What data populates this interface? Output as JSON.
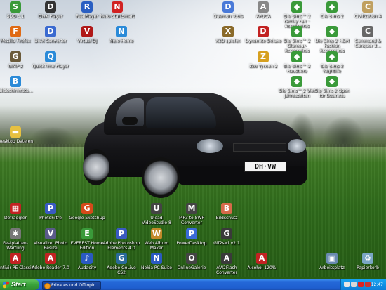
{
  "desktop": {
    "icons": [
      {
        "id": "sdl",
        "label": "SDD 3.1",
        "icon": "sdd-icon",
        "color": "#3a9a3a",
        "glyph": "S"
      },
      {
        "id": "divx-player",
        "label": "DivX Player",
        "icon": "divx-player-icon",
        "color": "#333333",
        "glyph": "D"
      },
      {
        "id": "realplayer",
        "label": "RealPlayer",
        "icon": "realplayer-icon",
        "color": "#2a5fc2",
        "glyph": "R"
      },
      {
        "id": "nero-startsmart",
        "label": "Nero StartSmart",
        "icon": "nero-icon",
        "color": "#d12222",
        "glyph": "N"
      },
      {
        "id": "mozilla-firefox",
        "label": "Mozilla Firefox",
        "icon": "firefox-icon",
        "color": "#e06a14",
        "glyph": "F"
      },
      {
        "id": "divx-converter",
        "label": "DivX Converter",
        "icon": "divx-converter-icon",
        "color": "#3a6ad0",
        "glyph": "D"
      },
      {
        "id": "virtual-dj",
        "label": "Virtual DJ",
        "icon": "virtual-dj-icon",
        "color": "#b01818",
        "glyph": "V"
      },
      {
        "id": "nero-home",
        "label": "Nero Home",
        "icon": "nero-home-icon",
        "color": "#2a8ad8",
        "glyph": "N"
      },
      {
        "id": "gimp",
        "label": "GIMP 2",
        "icon": "gimp-icon",
        "color": "#6a5a3a",
        "glyph": "G"
      },
      {
        "id": "quicktime",
        "label": "QuickTime Player",
        "icon": "quicktime-icon",
        "color": "#2a8ad8",
        "glyph": "Q"
      },
      {
        "id": "bildschirmfoto",
        "label": "Bildschirmfoto...",
        "icon": "screenshot-icon",
        "color": "#2a8ad8",
        "glyph": "B"
      },
      {
        "id": "desktop-dateien",
        "label": "Desktop Dateien",
        "icon": "folder-icon",
        "color": "#e6c040",
        "glyph": "▬"
      },
      {
        "id": "daemon-tools",
        "label": "Daemon Tools",
        "icon": "daemon-tools-icon",
        "color": "#4a7ad8",
        "glyph": "D"
      },
      {
        "id": "afuca",
        "label": "AFUCA",
        "icon": "afuca-icon",
        "color": "#888888",
        "glyph": "A"
      },
      {
        "id": "sims2-family",
        "label": "Die Sims™ 2 Family Fun – Accessoires",
        "icon": "sims-icon",
        "color": "#3a9a3a",
        "glyph": "◆"
      },
      {
        "id": "sims2",
        "label": "Die Sims 2",
        "icon": "sims-icon",
        "color": "#3a9a3a",
        "glyph": "◆"
      },
      {
        "id": "civilization",
        "label": "Civilization 4",
        "icon": "civilization-icon",
        "color": "#c0a060",
        "glyph": "C"
      },
      {
        "id": "x3d-spielen",
        "label": "X3D spielen",
        "icon": "x3d-icon",
        "color": "#8a6a2a",
        "glyph": "X"
      },
      {
        "id": "dynamite-deluxe",
        "label": "Dynamite Deluxe",
        "icon": "dynamite-icon",
        "color": "#c22222",
        "glyph": "D"
      },
      {
        "id": "sims2-glamour",
        "label": "Die Sims™ 2 Glamour-Accessoires",
        "icon": "sims-icon",
        "color": "#3a9a3a",
        "glyph": "◆"
      },
      {
        "id": "sims2-h-m",
        "label": "Die Sims 2 H&M Fashion Accessoires",
        "icon": "sims-icon",
        "color": "#3a9a3a",
        "glyph": "◆"
      },
      {
        "id": "command-conquer",
        "label": "Command & Conquer 3...",
        "icon": "command-conquer-icon",
        "color": "#666666",
        "glyph": "C"
      },
      {
        "id": "zoo-tycoon",
        "label": "Zoo Tycoon 2",
        "icon": "zoo-tycoon-icon",
        "color": "#d6a020",
        "glyph": "Z"
      },
      {
        "id": "sims2-haustiere",
        "label": "Die Sims™ 2 Haustiere",
        "icon": "sims-icon",
        "color": "#3a9a3a",
        "glyph": "◆"
      },
      {
        "id": "sims2-nightlife",
        "label": "Die Sims 2 Nightlife",
        "icon": "sims-icon",
        "color": "#3a9a3a",
        "glyph": "◆"
      },
      {
        "id": "sims2-jahreszeiten",
        "label": "Die Sims™ 2 Vier Jahreszeiten",
        "icon": "sims-icon",
        "color": "#3a9a3a",
        "glyph": "◆"
      },
      {
        "id": "sims2-open",
        "label": "Die Sims 2 Open for Business",
        "icon": "sims-icon",
        "color": "#3a9a3a",
        "glyph": "◆"
      },
      {
        "id": "defraggler",
        "label": "Defraggler",
        "icon": "defraggler-icon",
        "color": "#c22222",
        "glyph": "▦"
      },
      {
        "id": "photofiltre",
        "label": "PhotoFiltre",
        "icon": "photofiltre-icon",
        "color": "#3a5ac2",
        "glyph": "P"
      },
      {
        "id": "google-sketchup",
        "label": "Google SketchUp",
        "icon": "sketchup-icon",
        "color": "#d64a1a",
        "glyph": "G"
      },
      {
        "id": "ulead-videostudio",
        "label": "Ulead VideoStudio 8",
        "icon": "ulead-icon",
        "color": "#444444",
        "glyph": "U"
      },
      {
        "id": "mp3-to-swf",
        "label": "MP3 to SWF Converter",
        "icon": "mp3-swf-icon",
        "color": "#444444",
        "glyph": "M"
      },
      {
        "id": "bildschutz",
        "label": "Bildschutz",
        "icon": "bildschutz-icon",
        "color": "#d66a4a",
        "glyph": "B"
      },
      {
        "id": "festplatten-wartung",
        "label": "Festplatten-Wartung",
        "icon": "wrench-icon",
        "color": "#777777",
        "glyph": "✱"
      },
      {
        "id": "visualizer",
        "label": "Visualizer Photo Resize",
        "icon": "visualizer-icon",
        "color": "#5a5a8a",
        "glyph": "V"
      },
      {
        "id": "everest",
        "label": "EVEREST Home Edition",
        "icon": "everest-icon",
        "color": "#3a9a3a",
        "glyph": "E"
      },
      {
        "id": "photoshop-elements",
        "label": "Adobe Photoshop Elements 4.0",
        "icon": "photoshop-icon",
        "color": "#3a5ac2",
        "glyph": "P"
      },
      {
        "id": "web-album-maker",
        "label": "Web Album Maker",
        "icon": "web-album-icon",
        "color": "#c28a2a",
        "glyph": "W"
      },
      {
        "id": "powerdesktop",
        "label": "PowerDesktop",
        "icon": "powerdesktop-icon",
        "color": "#3a6ad8",
        "glyph": "P"
      },
      {
        "id": "gif2swf",
        "label": "Gif2swf v2.1",
        "icon": "gif2swf-icon",
        "color": "#3a3a3a",
        "glyph": "G"
      },
      {
        "id": "antivir",
        "label": "AntiVir PE Classic",
        "icon": "antivir-icon",
        "color": "#c22222",
        "glyph": "A"
      },
      {
        "id": "adobe-reader",
        "label": "Adobe Reader 7.0",
        "icon": "adobe-reader-icon",
        "color": "#c22222",
        "glyph": "A"
      },
      {
        "id": "audacity",
        "label": "Audacity",
        "icon": "audacity-icon",
        "color": "#2a5ac2",
        "glyph": "♪"
      },
      {
        "id": "adobe-golive",
        "label": "Adobe GoLive CS2",
        "icon": "golive-icon",
        "color": "#2a6a9a",
        "glyph": "G"
      },
      {
        "id": "nokia-pc-suite",
        "label": "Nokia PC Suite",
        "icon": "nokia-icon",
        "color": "#2a5ac2",
        "glyph": "N"
      },
      {
        "id": "online-galerie",
        "label": "OnlineGalerie",
        "icon": "online-galerie-icon",
        "color": "#444444",
        "glyph": "O"
      },
      {
        "id": "avi2flash",
        "label": "AVI2Flash Converter",
        "icon": "avi2flash-icon",
        "color": "#3a3a3a",
        "glyph": "A"
      },
      {
        "id": "alcohol",
        "label": "Alcohol 120%",
        "icon": "alcohol-icon",
        "color": "#c22222",
        "glyph": "A"
      },
      {
        "id": "arbeitsplatz",
        "label": "Arbeitsplatz",
        "icon": "computer-icon",
        "color": "#6a8ab0",
        "glyph": "▣"
      },
      {
        "id": "papierkorb",
        "label": "Papierkorb",
        "icon": "recycle-bin-icon",
        "color": "#7aa6c4",
        "glyph": "♻"
      }
    ],
    "car_plate": "DH·VW"
  },
  "taskbar": {
    "start_label": "Start",
    "task_button_label": "Privates und Offtopic...",
    "clock": "12:47",
    "tray_icons": [
      "network-icon",
      "speaker-icon",
      "antivir-tray-icon",
      "messenger-icon"
    ]
  },
  "colors": {
    "taskbar_blue": "#245ed8",
    "start_green": "#3aa33a",
    "tray_blue": "#0f7ed8"
  }
}
